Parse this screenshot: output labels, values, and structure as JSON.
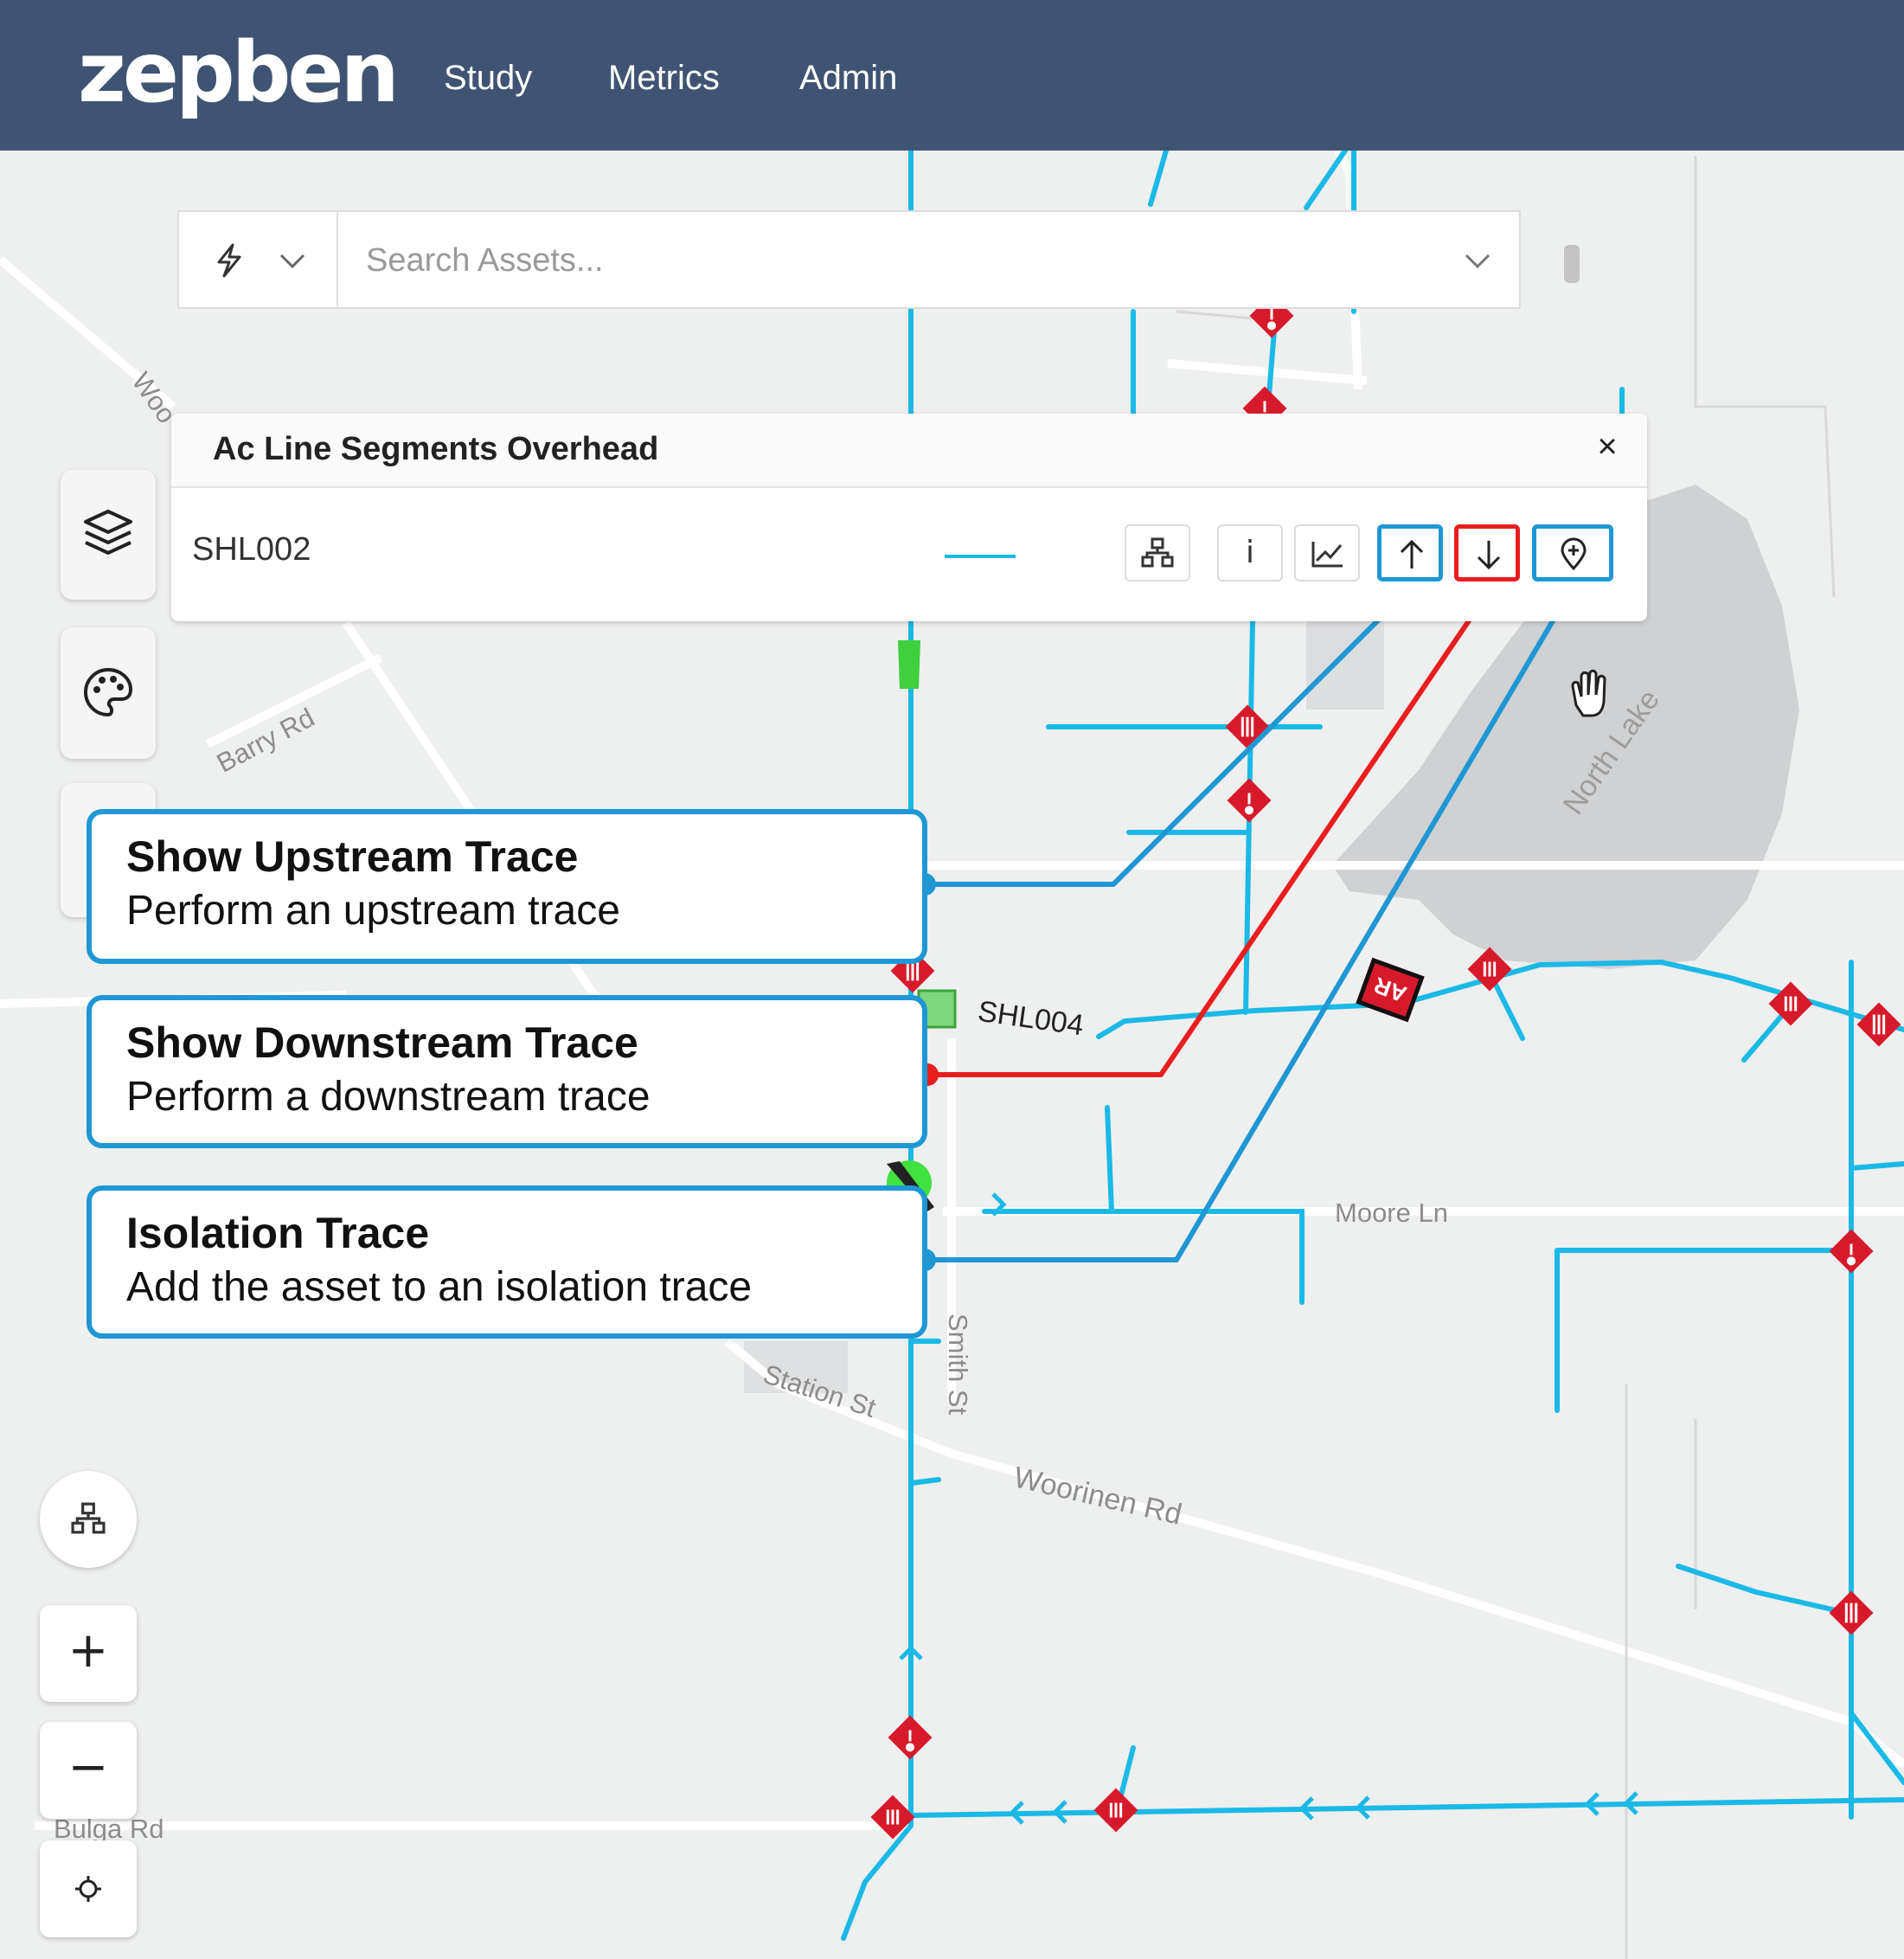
{
  "app": {
    "logo_text": "zepben",
    "nav": [
      "Study",
      "Metrics",
      "Admin"
    ]
  },
  "search": {
    "placeholder": "Search Assets...",
    "filter_icon": "lightning-icon",
    "dropdown_icon": "chevron-down-icon"
  },
  "panel": {
    "title": "Ac Line Segments Overhead",
    "close_label": "×",
    "asset_id": "SHL002",
    "line_color": "#1ab9e6",
    "actions": [
      {
        "name": "network-diagram-button",
        "icon": "network-icon"
      },
      {
        "name": "info-button",
        "icon": "info-icon",
        "label": "i"
      },
      {
        "name": "chart-button",
        "icon": "chart-line-icon"
      },
      {
        "name": "upstream-trace-button",
        "icon": "arrow-up-icon",
        "highlight": "#1f97d4"
      },
      {
        "name": "downstream-trace-button",
        "icon": "arrow-down-icon",
        "highlight": "#e81e1e"
      },
      {
        "name": "isolation-trace-button",
        "icon": "location-plus-icon",
        "highlight": "#1f97d4"
      }
    ]
  },
  "callouts": [
    {
      "title": "Show Upstream Trace",
      "desc": "Perform an upstream trace",
      "color": "#1f97d4"
    },
    {
      "title": "Show Downstream Trace",
      "desc": "Perform a downstream trace",
      "color": "#e81e1e"
    },
    {
      "title": "Isolation Trace",
      "desc": "Add the asset to an isolation trace",
      "color": "#1f97d4"
    }
  ],
  "map": {
    "labels": {
      "woo": "Woo",
      "barry": "Barry Rd",
      "north_lake": "North Lake",
      "shl004": "SHL004",
      "moore": "Moore Ln",
      "smith": "Smith St",
      "station": "Station St",
      "woorinen": "Woorinen Rd",
      "bulga": "Bulga Rd",
      "ar_badge": "AR"
    },
    "line_color": "#1ab9e6",
    "asset_color": "#d71a2b",
    "water_color": "#cfd1d3"
  },
  "controls": {
    "sidebar": [
      "layers-icon",
      "palette-icon"
    ],
    "map": [
      "network-icon",
      "zoom-in-icon",
      "zoom-out-icon",
      "locate-icon"
    ],
    "zoom_in_label": "+",
    "zoom_out_label": "−"
  }
}
